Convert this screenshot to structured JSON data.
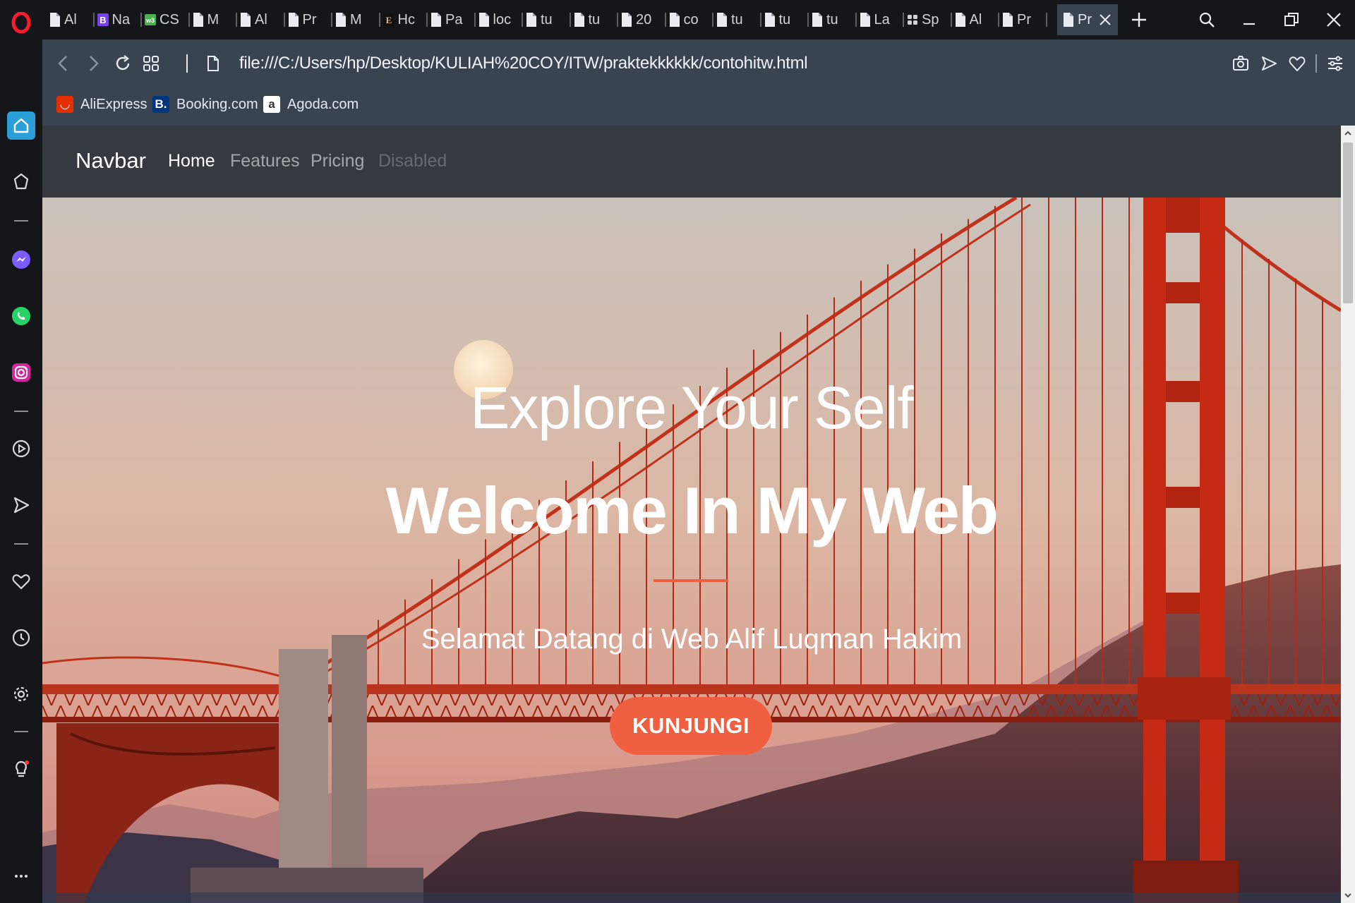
{
  "browser": {
    "tabs": [
      {
        "label": "Al",
        "kind": "file"
      },
      {
        "label": "Na",
        "kind": "bold-b"
      },
      {
        "label": "CS",
        "kind": "w3"
      },
      {
        "label": "M",
        "kind": "file"
      },
      {
        "label": "Al",
        "kind": "file"
      },
      {
        "label": "Pr",
        "kind": "file"
      },
      {
        "label": "M",
        "kind": "file"
      },
      {
        "label": "Hc",
        "kind": "e-icon"
      },
      {
        "label": "Pa",
        "kind": "file"
      },
      {
        "label": "loc",
        "kind": "file"
      },
      {
        "label": "tu",
        "kind": "file"
      },
      {
        "label": "tu",
        "kind": "file"
      },
      {
        "label": "20",
        "kind": "file"
      },
      {
        "label": "co",
        "kind": "file"
      },
      {
        "label": "tu",
        "kind": "file"
      },
      {
        "label": "tu",
        "kind": "file"
      },
      {
        "label": "tu",
        "kind": "file"
      },
      {
        "label": "La",
        "kind": "file"
      },
      {
        "label": "Sp",
        "kind": "grid"
      },
      {
        "label": "Al",
        "kind": "file"
      },
      {
        "label": "Pr",
        "kind": "file"
      }
    ],
    "active_tab": {
      "label": "Pr"
    },
    "url": "file:///C:/Users/hp/Desktop/KULIAH%20COY/ITW/praktekkkkkk/contohitw.html",
    "bookmarks": [
      {
        "label": "AliExpress",
        "icon": "aliexpress-icon",
        "color": "#e62e04"
      },
      {
        "label": "Booking.com",
        "icon": "booking-icon",
        "color": "#003580"
      },
      {
        "label": "Agoda.com",
        "icon": "agoda-icon",
        "color": "#ffffff"
      }
    ]
  },
  "navbar": {
    "brand": "Navbar",
    "links": [
      "Home",
      "Features",
      "Pricing",
      "Disabled"
    ]
  },
  "hero": {
    "subtitle": "Explore Your Self",
    "title": "Welcome In My Web",
    "text": "Selamat Datang di Web Alif Luqman Hakim",
    "button": "KUNJUNGI"
  },
  "colors": {
    "accent": "#f05f40",
    "navbar_bg": "#343a40",
    "browser_bg": "#3a4350",
    "bridge": "#d63a1c"
  }
}
